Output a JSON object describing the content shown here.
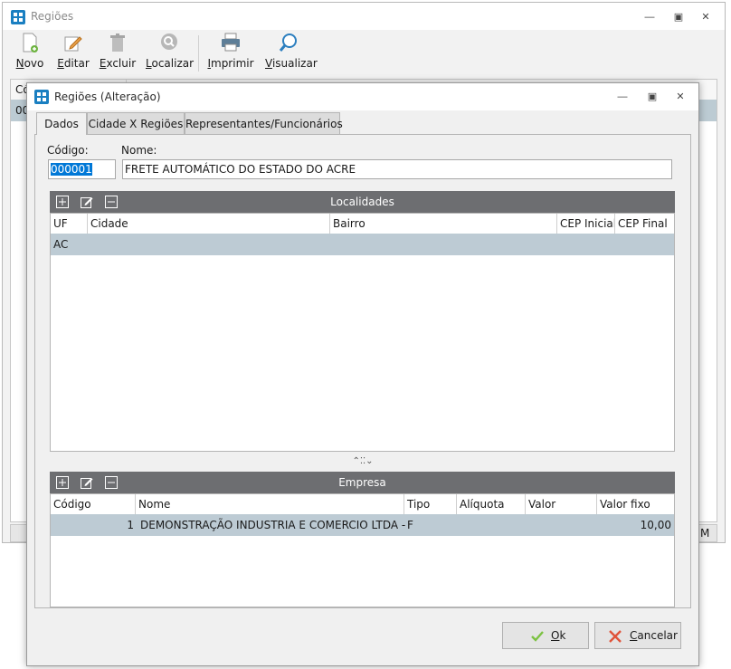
{
  "background_window": {
    "title": "Regiões",
    "toolbar": [
      {
        "key": "N",
        "rest": "ovo",
        "icon": "new-document-icon"
      },
      {
        "key": "E",
        "rest": "ditar",
        "icon": "edit-pencil-icon"
      },
      {
        "key": "E",
        "rest": "xcluir",
        "pre": "",
        "icon": "trash-icon"
      },
      {
        "key": "L",
        "rest": "ocalizar",
        "icon": "search-icon"
      },
      {
        "key": "I",
        "rest": "mprimir",
        "icon": "printer-icon"
      },
      {
        "key": "V",
        "rest": "isualizar",
        "icon": "preview-icon"
      }
    ],
    "grid_header_partial": "Có",
    "grid_row_partial": "00",
    "status_partial": "M"
  },
  "dialog": {
    "title": "Regiões (Alteração)",
    "tabs": [
      "Dados",
      "Cidade X Regiões",
      "Representantes/Funcionários"
    ],
    "codigo_label": "Código:",
    "codigo_value": "000001",
    "nome_label": "Nome:",
    "nome_value": "FRETE AUTOMÁTICO DO ESTADO DO ACRE",
    "localidades": {
      "title": "Localidades",
      "columns": [
        "UF",
        "Cidade",
        "Bairro",
        "CEP Inicial",
        "CEP Final"
      ],
      "rows": [
        [
          "AC",
          "",
          "",
          "",
          ""
        ]
      ]
    },
    "splitter_glyph": "⌃⁚⁚⌄",
    "empresa": {
      "title": "Empresa",
      "columns": [
        "Código",
        "Nome",
        "Tipo",
        "Alíquota",
        "Valor",
        "Valor fixo"
      ],
      "rows": [
        [
          "1",
          "DEMONSTRAÇÃO INDUSTRIA E COMERCIO LTDA -",
          "F",
          "",
          "",
          "10,00"
        ]
      ]
    },
    "ok_label_key": "O",
    "ok_label_rest": "k",
    "cancel_label_key": "C",
    "cancel_label_rest": "ancelar"
  },
  "colors": {
    "panel_bar": "#6d6e71",
    "selected_row": "#bdcbd4",
    "selection": "#0078d7",
    "ok_check": "#7cc242",
    "cancel_x": "#e0533a",
    "app_icon": "#1a7fc1"
  }
}
